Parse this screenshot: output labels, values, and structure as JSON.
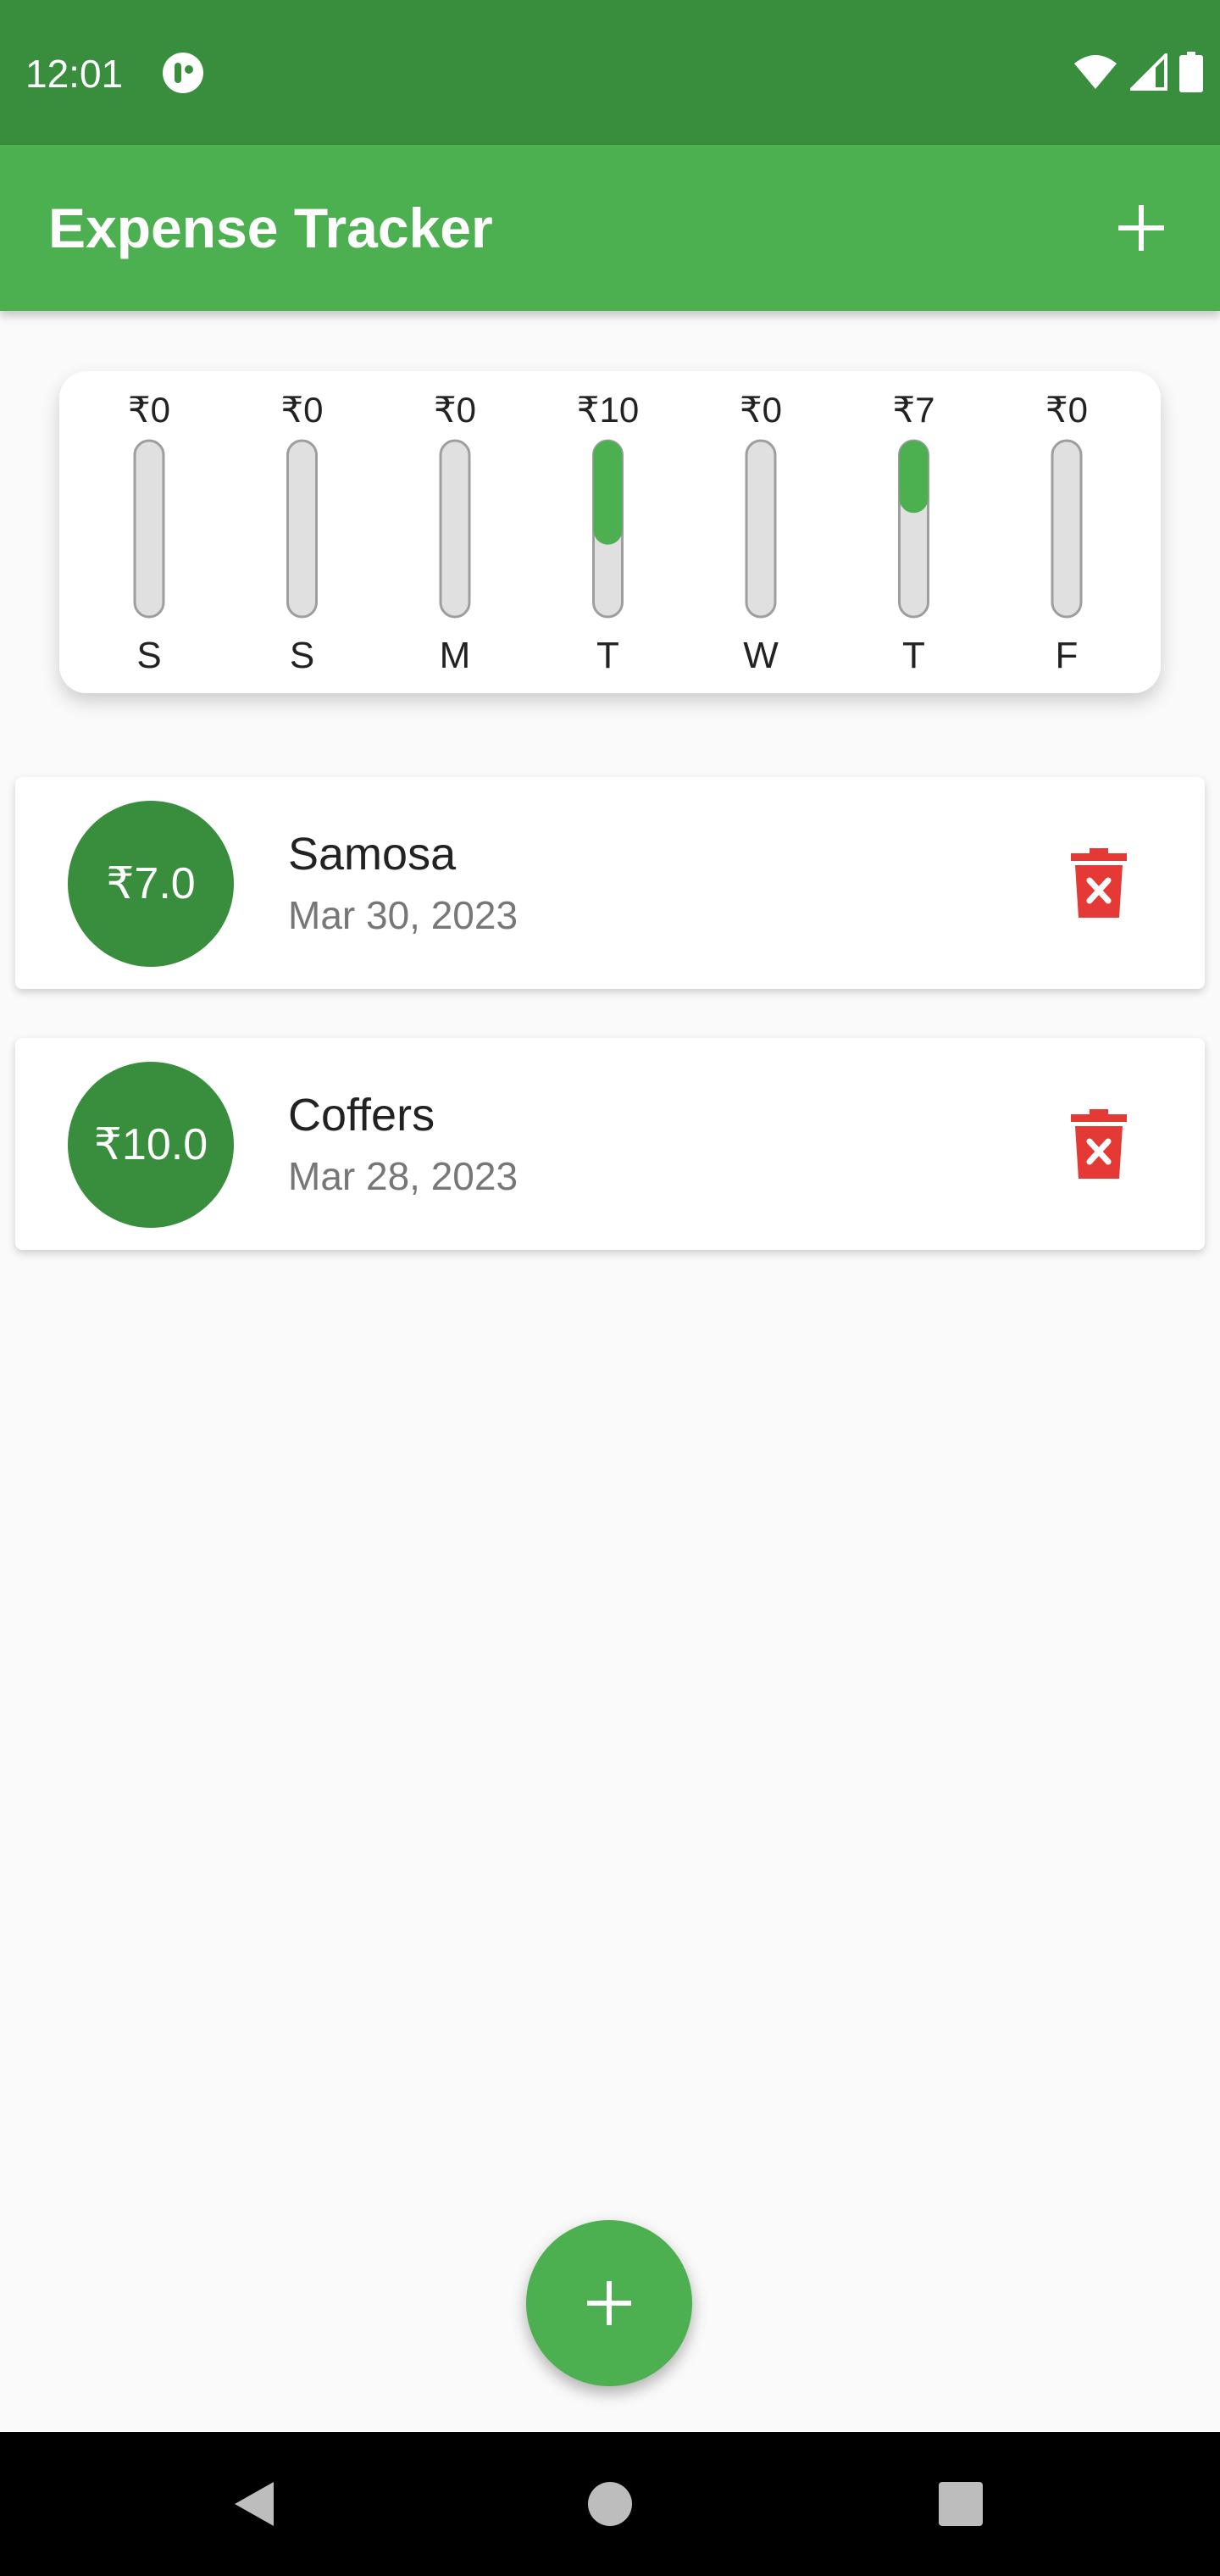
{
  "status_bar": {
    "time": "12:01"
  },
  "app_bar": {
    "title": "Expense Tracker"
  },
  "chart_data": {
    "type": "bar",
    "categories": [
      "S",
      "S",
      "M",
      "T",
      "W",
      "T",
      "F"
    ],
    "value_labels": [
      "₹0",
      "₹0",
      "₹0",
      "₹10",
      "₹0",
      "₹7",
      "₹0"
    ],
    "fill_fractions": [
      0,
      0,
      0,
      0.59,
      0,
      0.41,
      0
    ],
    "colors": {
      "fill": "#4caf50",
      "track": "#e0e0e0",
      "track_border": "#9e9e9e"
    }
  },
  "expenses": [
    {
      "amount": "₹7.0",
      "title": "Samosa",
      "date": "Mar 30, 2023"
    },
    {
      "amount": "₹10.0",
      "title": "Coffers",
      "date": "Mar 28, 2023"
    }
  ],
  "colors": {
    "primary": "#4caf50",
    "primary_dark": "#388e3c",
    "delete": "#e53935"
  }
}
